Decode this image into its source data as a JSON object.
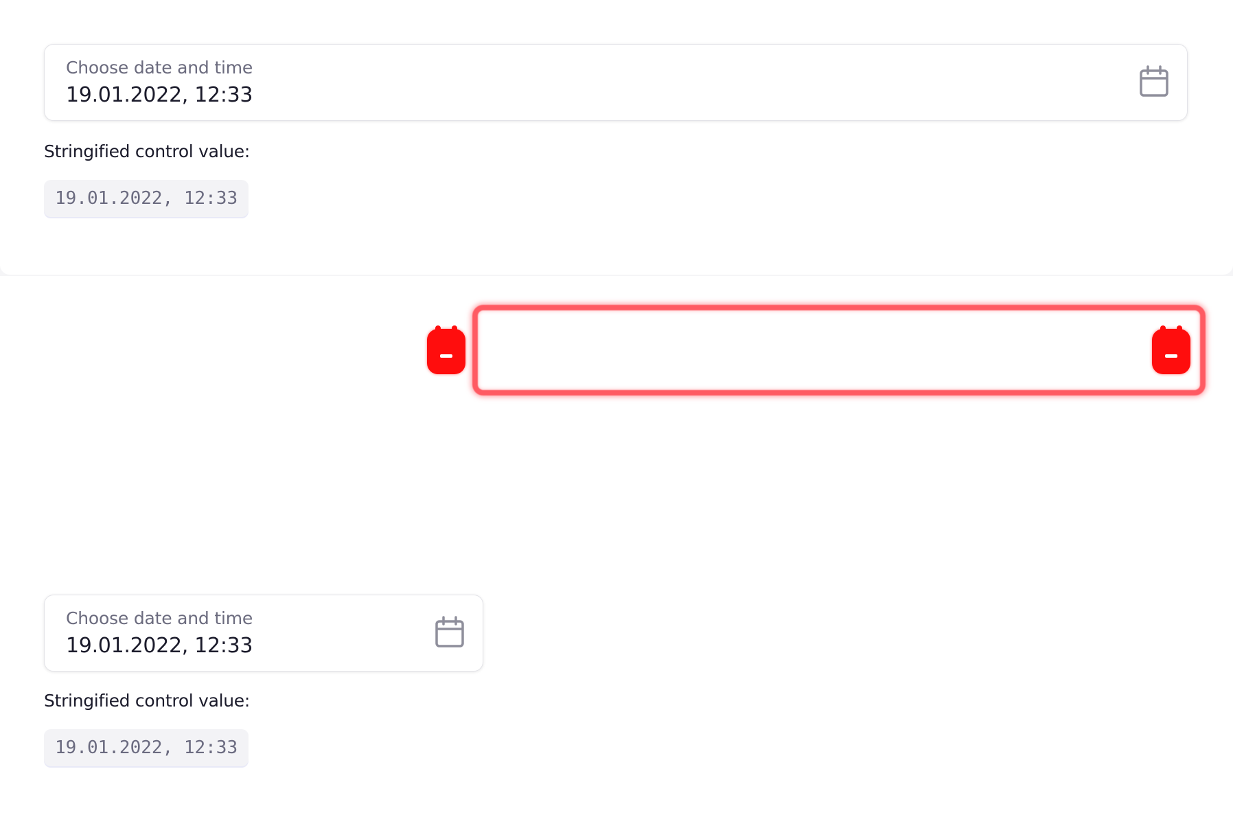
{
  "examples": [
    {
      "field": {
        "label": "Choose date and time",
        "value": "19.01.2022, 12:33",
        "icon": "calendar-icon"
      },
      "caption": "Stringified control value:",
      "stringified": "19.01.2022, 12:33"
    },
    {
      "field": {
        "label": "Choose date and time",
        "value": "19.01.2022, 12:33",
        "icon": "calendar-icon"
      },
      "caption": "Stringified control value:",
      "stringified": "19.01.2022, 12:33"
    }
  ],
  "overlay": {
    "color": "#ff0d0d",
    "icons": [
      "calendar-icon",
      "calendar-icon"
    ]
  }
}
